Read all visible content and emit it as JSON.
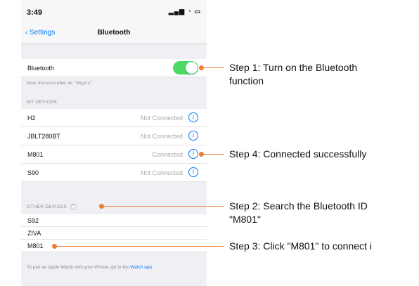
{
  "status_bar": {
    "time": "3:49",
    "icons": "signal-wifi-battery"
  },
  "nav": {
    "back": "Settings",
    "title": "Bluetooth"
  },
  "bluetooth_row": {
    "label": "Bluetooth",
    "toggle_on": true
  },
  "discoverable": "Now discoverable as \"Miya's\".",
  "my_devices": {
    "header": "MY DEVICES",
    "items": [
      {
        "name": "H2",
        "status": "Not Connected"
      },
      {
        "name": "JBLT280BT",
        "status": "Not Connected"
      },
      {
        "name": "M801",
        "status": "Connected"
      },
      {
        "name": "S90",
        "status": "Not Connected"
      }
    ]
  },
  "other_devices": {
    "header": "OTHER DEVICES",
    "items": [
      {
        "name": "S92"
      },
      {
        "name": "ZIVA"
      },
      {
        "name": "M801"
      }
    ]
  },
  "footer": {
    "text": "To pair an Apple Watch with your iPhone, go to the",
    "link": "Watch app."
  },
  "annotations": {
    "step1": "Step 1: Turn on the Bluetooth\n          function",
    "step4": "Step 4: Connected successfully",
    "step2": "Step 2: Search the Bluetooth ID\n          \"M801\"",
    "step3": "Step 3: Click \"M801\" to connect i"
  },
  "colors": {
    "accent": "#ee7d31",
    "ios_blue": "#007aff",
    "toggle_green": "#4cd964"
  }
}
